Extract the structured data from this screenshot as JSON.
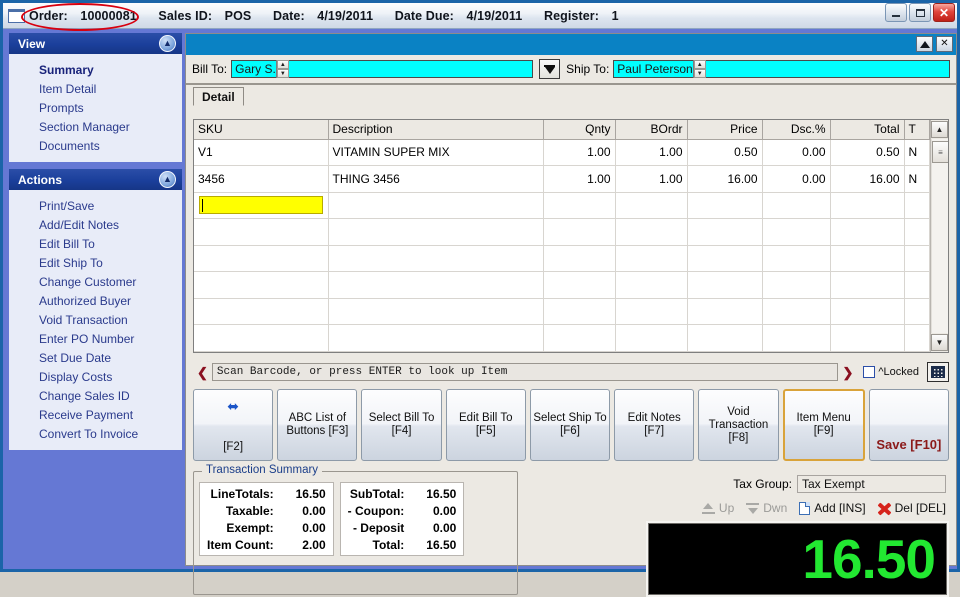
{
  "window": {
    "title_fields": [
      {
        "label": "Order:",
        "value": "10000081"
      },
      {
        "label": "Sales ID:",
        "value": "POS"
      },
      {
        "label": "Date:",
        "value": "4/19/2011"
      },
      {
        "label": "Date Due:",
        "value": "4/19/2011"
      },
      {
        "label": "Register:",
        "value": "1"
      }
    ],
    "minimize_label": "",
    "maximize_label": "",
    "close_label": "✕"
  },
  "sidebar": {
    "panels": [
      {
        "title": "View",
        "collapse_icon": "chevron-up-icon",
        "items": [
          {
            "label": "Summary",
            "active": true
          },
          {
            "label": "Item Detail",
            "active": false
          },
          {
            "label": "Prompts",
            "active": false
          },
          {
            "label": "Section Manager",
            "active": false
          },
          {
            "label": "Documents",
            "active": false
          }
        ]
      },
      {
        "title": "Actions",
        "collapse_icon": "chevron-up-icon",
        "items": [
          {
            "label": "Print/Save",
            "active": false
          },
          {
            "label": "Add/Edit Notes",
            "active": false
          },
          {
            "label": "Edit Bill To",
            "active": false
          },
          {
            "label": "Edit Ship To",
            "active": false
          },
          {
            "label": "Change Customer",
            "active": false
          },
          {
            "label": "Authorized Buyer",
            "active": false
          },
          {
            "label": "Void Transaction",
            "active": false
          },
          {
            "label": "Enter PO Number",
            "active": false
          },
          {
            "label": "Set Due Date",
            "active": false
          },
          {
            "label": "Display Costs",
            "active": false
          },
          {
            "label": "Change Sales ID",
            "active": false
          },
          {
            "label": "Receive Payment",
            "active": false
          },
          {
            "label": "Convert To Invoice",
            "active": false
          }
        ]
      }
    ]
  },
  "doc_panel": {
    "restore_label": "",
    "close_label": "✕",
    "bill_to": {
      "label": "Bill To:",
      "value": "Gary S."
    },
    "ship_to": {
      "label": "Ship To:",
      "value": "Paul Peterson"
    },
    "tabs": [
      {
        "label": "Detail",
        "active": true
      }
    ]
  },
  "grid": {
    "columns": [
      "SKU",
      "Description",
      "Qnty",
      "BOrdr",
      "Price",
      "Dsc.%",
      "Total",
      "T"
    ],
    "rows": [
      {
        "sku": "V1",
        "description": "VITAMIN SUPER MIX",
        "qnty": "1.00",
        "bordr": "1.00",
        "price": "0.50",
        "dsc": "0.00",
        "total": "0.50",
        "t": "N"
      },
      {
        "sku": "3456",
        "description": "THING 3456",
        "qnty": "1.00",
        "bordr": "1.00",
        "price": "16.00",
        "dsc": "0.00",
        "total": "16.00",
        "t": "N"
      }
    ],
    "editing_row_value": ""
  },
  "scan_bar": {
    "prev_icon": "chevron-left-icon",
    "next_icon": "chevron-right-icon",
    "placeholder": "Scan Barcode, or press ENTER to look up Item",
    "value": "",
    "locked_label": "^Locked",
    "locked_checked": false,
    "keypad_icon": "keypad-icon"
  },
  "function_buttons": [
    {
      "name": "resize",
      "icon": "double-arrow-icon",
      "icon_glyph": "⬌",
      "label": "[F2]",
      "style": "icon",
      "focused": false
    },
    {
      "name": "abc-list-of-buttons",
      "label": "ABC List of Buttons [F3]",
      "style": "text",
      "focused": false
    },
    {
      "name": "select-bill-to",
      "label": "Select Bill To [F4]",
      "style": "text",
      "focused": false
    },
    {
      "name": "edit-bill-to",
      "label": "Edit Bill To [F5]",
      "style": "text",
      "focused": false
    },
    {
      "name": "select-ship-to",
      "label": "Select Ship To [F6]",
      "style": "text",
      "focused": false
    },
    {
      "name": "edit-notes",
      "label": "Edit Notes [F7]",
      "style": "text",
      "focused": false
    },
    {
      "name": "void-transaction",
      "label": "Void Transaction [F8]",
      "style": "text",
      "focused": false
    },
    {
      "name": "item-menu",
      "label": "Item Menu [F9]",
      "style": "text",
      "focused": true
    },
    {
      "name": "save",
      "label": "Save [F10]",
      "style": "save",
      "focused": false
    }
  ],
  "transaction_summary": {
    "legend": "Transaction Summary",
    "left_rows": [
      {
        "label": "LineTotals:",
        "value": "16.50"
      },
      {
        "label": "Taxable:",
        "value": "0.00"
      },
      {
        "label": "Exempt:",
        "value": "0.00"
      },
      {
        "label": "Item Count:",
        "value": "2.00"
      }
    ],
    "right_rows": [
      {
        "label": "SubTotal:",
        "value": "16.50"
      },
      {
        "label": "- Coupon:",
        "value": "0.00"
      },
      {
        "label": "- Deposit",
        "value": "0.00"
      },
      {
        "label": "Total:",
        "value": "16.50"
      }
    ]
  },
  "tax_group": {
    "label": "Tax Group:",
    "value": "Tax Exempt"
  },
  "row_tools": [
    {
      "name": "move-up",
      "label": "Up",
      "icon": "arrow-up-icon",
      "enabled": false
    },
    {
      "name": "move-down",
      "label": "Dwn",
      "icon": "arrow-down-icon",
      "enabled": false
    },
    {
      "name": "add-row",
      "label": "Add [INS]",
      "icon": "page-add-icon",
      "enabled": true
    },
    {
      "name": "delete-row",
      "label": "Del [DEL]",
      "icon": "red-x-icon",
      "enabled": true
    }
  ],
  "led_display": {
    "value": "16.50",
    "color": "#22e831"
  },
  "colors": {
    "sidebar_bg": "#6578d4",
    "panel_header": "#1b3f9b",
    "doc_header": "#0a82c4",
    "field_cyan": "#00ffff",
    "edit_yellow": "#ffff00",
    "save_red": "#8b1a1a",
    "annotation_red": "#d7000f",
    "focus_gold": "#d9a33a",
    "led_green": "#22e831"
  }
}
